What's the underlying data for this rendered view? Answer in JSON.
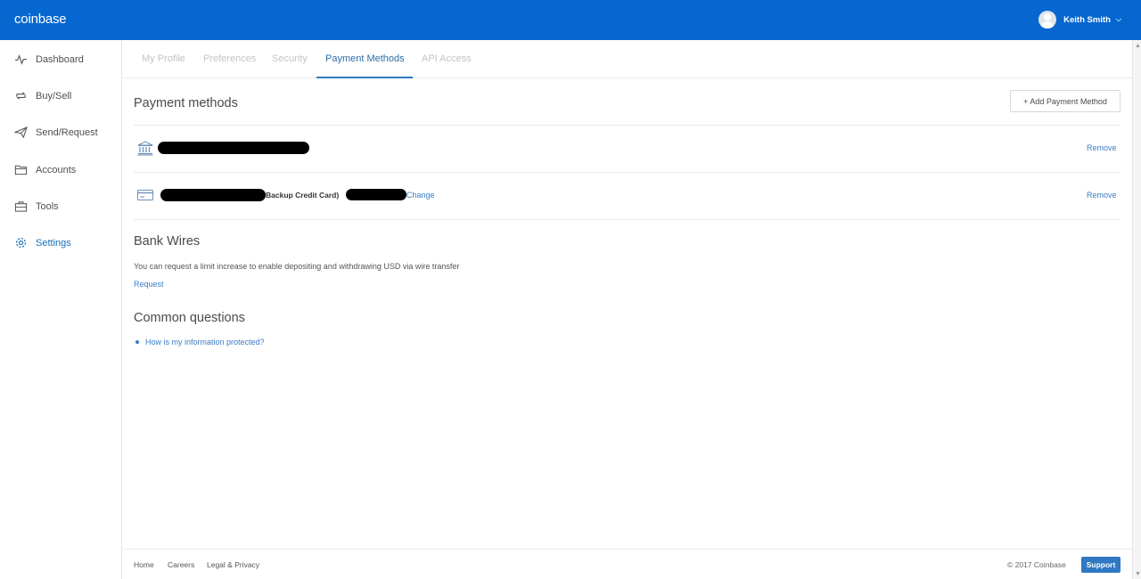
{
  "app": {
    "logo": "coinbase"
  },
  "header": {
    "user_name": "Keith Smith",
    "user_chevron": "⌵"
  },
  "sidebar": {
    "items": [
      {
        "label": "Dashboard",
        "icon": "pulse-icon"
      },
      {
        "label": "Buy/Sell",
        "icon": "exchange-icon"
      },
      {
        "label": "Send/Request",
        "icon": "paper-plane-icon"
      },
      {
        "label": "Accounts",
        "icon": "folder-icon"
      },
      {
        "label": "Tools",
        "icon": "toolbox-icon"
      },
      {
        "label": "Settings",
        "icon": "gear-icon",
        "active": true
      }
    ]
  },
  "tabs": [
    {
      "label": "My Profile"
    },
    {
      "label": "Preferences"
    },
    {
      "label": "Security"
    },
    {
      "label": "Payment Methods",
      "active": true
    },
    {
      "label": "API Access"
    }
  ],
  "payment_methods": {
    "title": "Payment methods",
    "add_button": "+ Add Payment Method",
    "rows": [
      {
        "icon": "bank-icon",
        "label_redacted": true,
        "remove": "Remove"
      },
      {
        "icon": "credit-card-icon",
        "suffix": "Backup Credit Card)",
        "change": "Change",
        "remove": "Remove"
      }
    ]
  },
  "bank_wires": {
    "title": "Bank Wires",
    "description": "You can request a limit increase to enable depositing and withdrawing USD via wire transfer",
    "request_link": "Request"
  },
  "common_questions": {
    "title": "Common questions",
    "items": [
      "How is my information protected?"
    ]
  },
  "footer": {
    "links": [
      "Home",
      "Careers",
      "Legal & Privacy"
    ],
    "copyright": "© 2017 Coinbase",
    "support": "Support"
  },
  "colors": {
    "brand": "#0667d0",
    "link": "#3a7cc4",
    "active_tab": "#2f79c2"
  }
}
